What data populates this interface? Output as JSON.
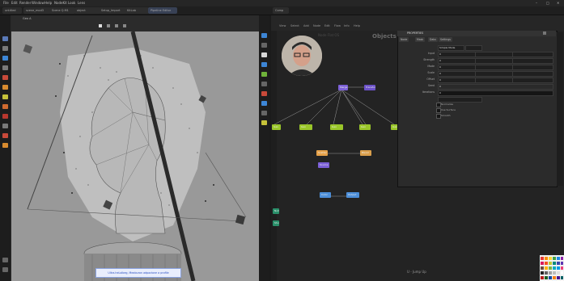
{
  "menubar": {
    "items": [
      "File",
      "Edit",
      "Render",
      "Window",
      "Help",
      "NodeKit",
      "Look",
      "Lens"
    ],
    "right_icons": [
      "minimize-icon",
      "maximize-icon",
      "close-icon"
    ]
  },
  "tabs": [
    "untitled",
    "scene_mod3",
    "Scene Q.M1",
    "object",
    "Setup_Import",
    "KitLab",
    "Pipeline Editor",
    "Comp"
  ],
  "viewport": {
    "header_label": "Geo A",
    "caption": "Ultra.heLolbeg, Meaburon adpazione a profile"
  },
  "node_editor": {
    "menu": [
      "View",
      "Select",
      "Add",
      "Node",
      "Edit",
      "Flow",
      "Info",
      "Help"
    ],
    "title_watermark": "Node Flat OS",
    "objects_label": "Objects",
    "nodes": [
      {
        "label": "Merge",
        "color": "#7b5fd6"
      },
      {
        "label": "Transform",
        "color": "#6b51c8"
      },
      {
        "label": "Geo",
        "color": "#9ac62a"
      },
      {
        "label": "Geo",
        "color": "#9ac62a"
      },
      {
        "label": "Geo",
        "color": "#9ac62a"
      },
      {
        "label": "Geo",
        "color": "#9ac62a"
      },
      {
        "label": "Geo",
        "color": "#9ac62a"
      },
      {
        "label": "Scatter",
        "color": "#e6a24a"
      },
      {
        "label": "Blend",
        "color": "#d99f4d"
      },
      {
        "label": "Source",
        "color": "#7b5fd6"
      },
      {
        "label": "Color",
        "color": "#4d8fd9"
      },
      {
        "label": "Output",
        "color": "#4d8fd9"
      },
      {
        "label": "Null",
        "color": "#2a8f6a"
      },
      {
        "label": "Shuffle",
        "color": "#2a8f6a"
      }
    ]
  },
  "properties": {
    "title": "PROPERTIES",
    "tabs": [
      "Node",
      "Mask",
      "Data",
      "Settings"
    ],
    "rows": [
      {
        "label": "Input",
        "value": "0"
      },
      {
        "label": "Strength",
        "value": "0"
      },
      {
        "label": "Mode",
        "value": "0"
      },
      {
        "label": "Scale",
        "value": "0"
      },
      {
        "label": "Offset",
        "value": "0"
      },
      {
        "label": "Seed",
        "value": "0"
      },
      {
        "label": "Iterations",
        "value": "0"
      }
    ],
    "dropdown": "Simple Mode",
    "checkboxes": [
      "Normalize",
      "Use Surface",
      "Smooth"
    ]
  },
  "hint": "U - Jump Up"
}
